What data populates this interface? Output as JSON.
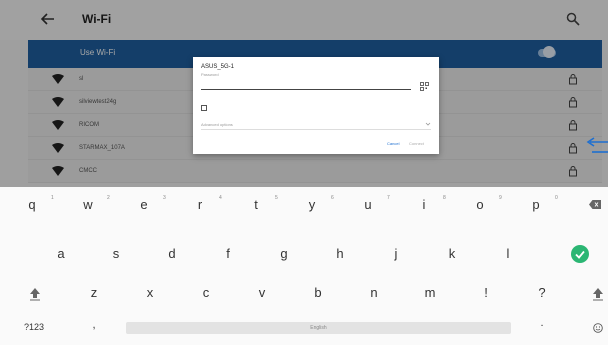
{
  "appbar": {
    "title": "Wi-Fi",
    "back_icon": "arrow-left-icon",
    "search_icon": "search-icon"
  },
  "use_wifi": {
    "label": "Use Wi-Fi",
    "enabled": true
  },
  "networks": [
    {
      "name": "sl",
      "secured": true
    },
    {
      "name": "silviewtest24g",
      "secured": true
    },
    {
      "name": "RICOM",
      "secured": true
    },
    {
      "name": "STARMAX_107A",
      "secured": true
    },
    {
      "name": "CMCC",
      "secured": true
    }
  ],
  "dialog": {
    "ssid": "ASUS_5G-1",
    "password_placeholder": "Password",
    "password_value": "",
    "advanced_options": "Advanced options",
    "cancel": "Cancel",
    "connect": "Connect"
  },
  "keyboard": {
    "row1": [
      "q",
      "w",
      "e",
      "r",
      "t",
      "y",
      "u",
      "i",
      "o",
      "p"
    ],
    "row1_hints": [
      "1",
      "2",
      "3",
      "4",
      "5",
      "6",
      "7",
      "8",
      "9",
      "0"
    ],
    "row2": [
      "a",
      "s",
      "d",
      "f",
      "g",
      "h",
      "j",
      "k",
      "l"
    ],
    "row3": [
      "z",
      "x",
      "c",
      "v",
      "b",
      "n",
      "m",
      "!",
      "?"
    ],
    "symbols_label": "?123",
    "comma": ",",
    "space_label": "English",
    "period": ".",
    "accent_color": "#2bb673",
    "dialog_accent": "#1e6fd0",
    "bar_color": "#1f5fa0"
  }
}
